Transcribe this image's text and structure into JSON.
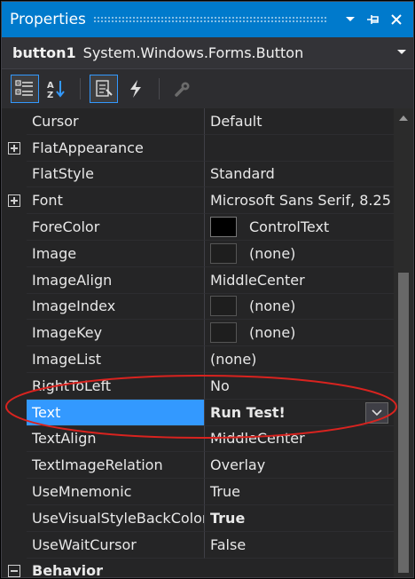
{
  "panel": {
    "title": "Properties",
    "pin_icon": "pin-icon",
    "close_icon": "close-icon"
  },
  "object_selector": {
    "name": "button1",
    "type": "System.Windows.Forms.Button"
  },
  "toolbar": {
    "tools": [
      "categorized-icon",
      "alphabetical-icon",
      "properties-icon",
      "events-icon",
      "property-pages-icon"
    ]
  },
  "rows": [
    {
      "name": "Cursor",
      "value": "Default"
    },
    {
      "name": "FlatAppearance",
      "value": ""
    },
    {
      "name": "FlatStyle",
      "value": "Standard"
    },
    {
      "name": "Font",
      "value": "Microsoft Sans Serif, 8.25"
    },
    {
      "name": "ForeColor",
      "value": "ControlText"
    },
    {
      "name": "Image",
      "value": "(none)"
    },
    {
      "name": "ImageAlign",
      "value": "MiddleCenter"
    },
    {
      "name": "ImageIndex",
      "value": "(none)"
    },
    {
      "name": "ImageKey",
      "value": "(none)"
    },
    {
      "name": "ImageList",
      "value": "(none)"
    },
    {
      "name": "RightToLeft",
      "value": "No"
    },
    {
      "name": "Text",
      "value": "Run Test!"
    },
    {
      "name": "TextAlign",
      "value": "MiddleCenter"
    },
    {
      "name": "TextImageRelation",
      "value": "Overlay"
    },
    {
      "name": "UseMnemonic",
      "value": "True"
    },
    {
      "name": "UseVisualStyleBackColor",
      "value": "True"
    },
    {
      "name": "UseWaitCursor",
      "value": "False"
    },
    {
      "name": "Behavior",
      "value": ""
    }
  ],
  "colors": {
    "accent": "#007acc",
    "selection": "#3399ff",
    "annotation": "#d9231f",
    "forecolor_swatch": "#000000"
  }
}
